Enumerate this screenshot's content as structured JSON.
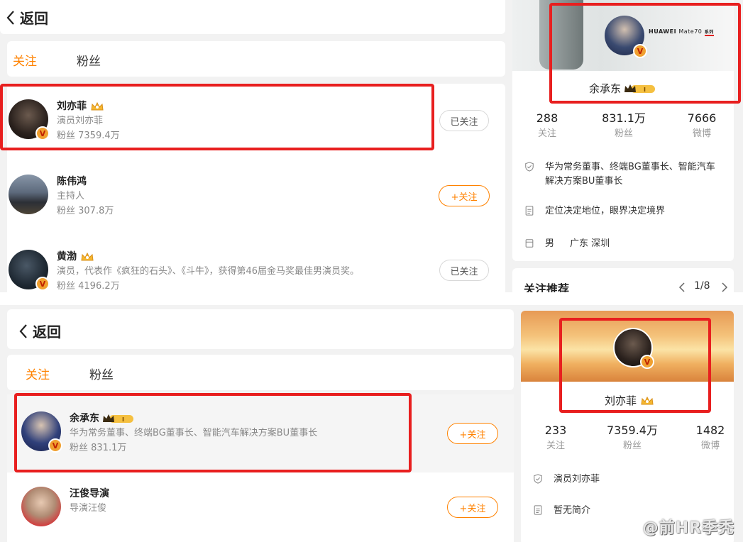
{
  "top": {
    "back_label": "返回",
    "tabs": [
      {
        "label": "关注"
      },
      {
        "label": "粉丝"
      }
    ],
    "users": [
      {
        "name": "刘亦菲",
        "desc": "演员刘亦菲",
        "fans": "粉丝 7359.4万",
        "button": "已关注"
      },
      {
        "name": "陈伟鸿",
        "desc": "主持人",
        "fans": "粉丝 307.8万",
        "button": "+关注"
      },
      {
        "name": "黄渤",
        "desc": "演员，代表作《疯狂的石头》、《斗牛》，获得第46届金马奖最佳男演员奖。",
        "fans": "粉丝 4196.2万",
        "button": "已关注"
      }
    ],
    "profile": {
      "brand_text": "HUAWEI",
      "model_text": "Mate70",
      "series_text": "系列",
      "name": "余承东",
      "stats": [
        {
          "num": "288",
          "label": "关注"
        },
        {
          "num": "831.1万",
          "label": "粉丝"
        },
        {
          "num": "7666",
          "label": "微博"
        }
      ],
      "title_line1": "华为常务董事、终端BG董事长、智能汽车",
      "title_line2": "解决方案BU董事长",
      "motto": "定位决定地位，眼界决定境界",
      "gender": "男",
      "location": "广东 深圳"
    },
    "recommend": {
      "label": "关注推荐",
      "pager": "1/8"
    }
  },
  "bottom": {
    "back_label": "返回",
    "tabs": [
      {
        "label": "关注"
      },
      {
        "label": "粉丝"
      }
    ],
    "users": [
      {
        "name": "余承东",
        "desc": "华为常务董事、终端BG董事长、智能汽车解决方案BU董事长",
        "fans": "粉丝 831.1万",
        "button": "+关注"
      },
      {
        "name": "汪俊导演",
        "desc": "导演汪俊",
        "button": "+关注"
      }
    ],
    "profile": {
      "name": "刘亦菲",
      "stats": [
        {
          "num": "233",
          "label": "关注"
        },
        {
          "num": "7359.4万",
          "label": "粉丝"
        },
        {
          "num": "1482",
          "label": "微博"
        }
      ],
      "title": "演员刘亦菲",
      "intro": "暂无简介"
    }
  },
  "watermark": "@前HR季秃",
  "colors": {
    "accent": "#ff8200",
    "highlight_box": "#e81f1f",
    "badge": "#f0a030"
  }
}
